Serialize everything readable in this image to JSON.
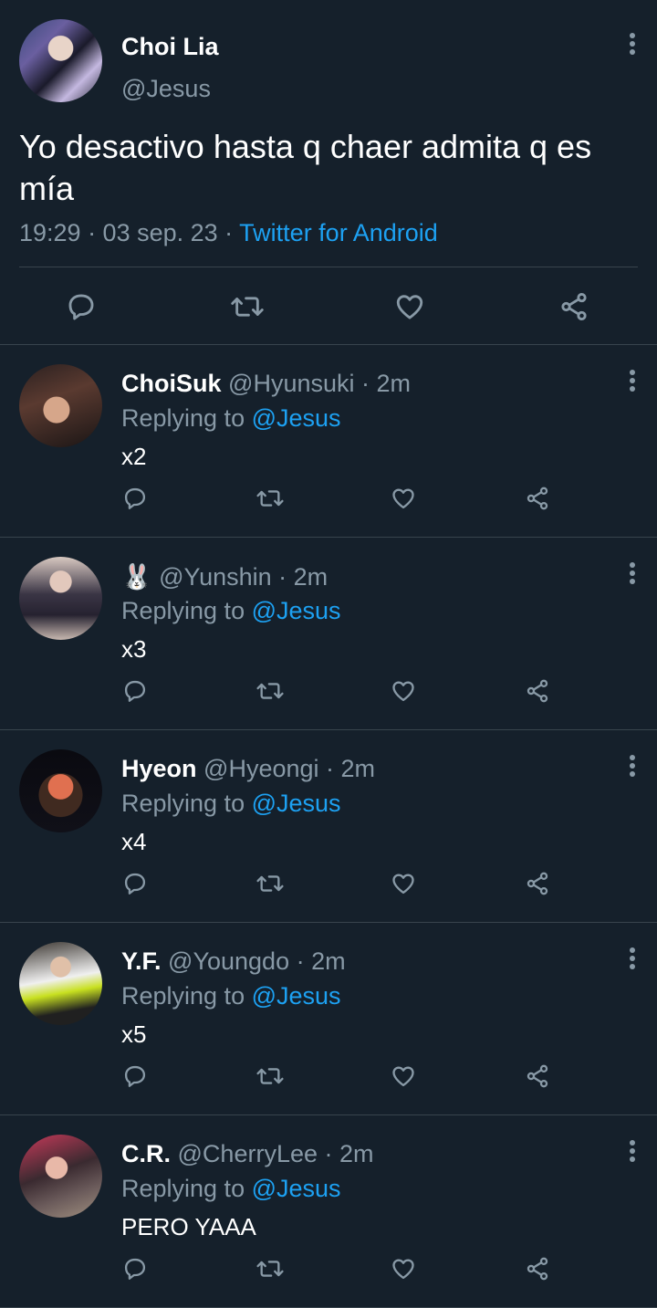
{
  "main_tweet": {
    "name": "Choi Lia",
    "handle": "@Jesus",
    "text": "Yo desactivo hasta q chaer admita q es mía",
    "time": "19:29 · 03 sep. 23 · ",
    "source": "Twitter for Android",
    "avatar_icon": "profile-photo",
    "actions": [
      "reply-icon",
      "retweet-icon",
      "like-icon",
      "share-icon"
    ]
  },
  "replies": [
    {
      "name": "ChoiSuk",
      "handle": "@Hyunsuki · 2m",
      "replying_prefix": "Replying to ",
      "mention": "@Jesus",
      "text": "x2"
    },
    {
      "name": "🐰",
      "handle": "@Yunshin · 2m",
      "replying_prefix": "Replying to ",
      "mention": "@Jesus",
      "text": "x3"
    },
    {
      "name": "Hyeon",
      "handle": "@Hyeongi · 2m",
      "replying_prefix": "Replying to ",
      "mention": "@Jesus",
      "text": "x4"
    },
    {
      "name": "Y.F.",
      "handle": "@Youngdo · 2m",
      "replying_prefix": "Replying to ",
      "mention": "@Jesus",
      "text": "x5"
    },
    {
      "name": "C.R.",
      "handle": "@CherryLee · 2m",
      "replying_prefix": "Replying to ",
      "mention": "@Jesus",
      "text": "PERO YAAA"
    }
  ],
  "colors": {
    "background": "#15202b",
    "secondary_text": "#8899a6",
    "accent": "#1da1f2",
    "divider": "#38444d"
  }
}
